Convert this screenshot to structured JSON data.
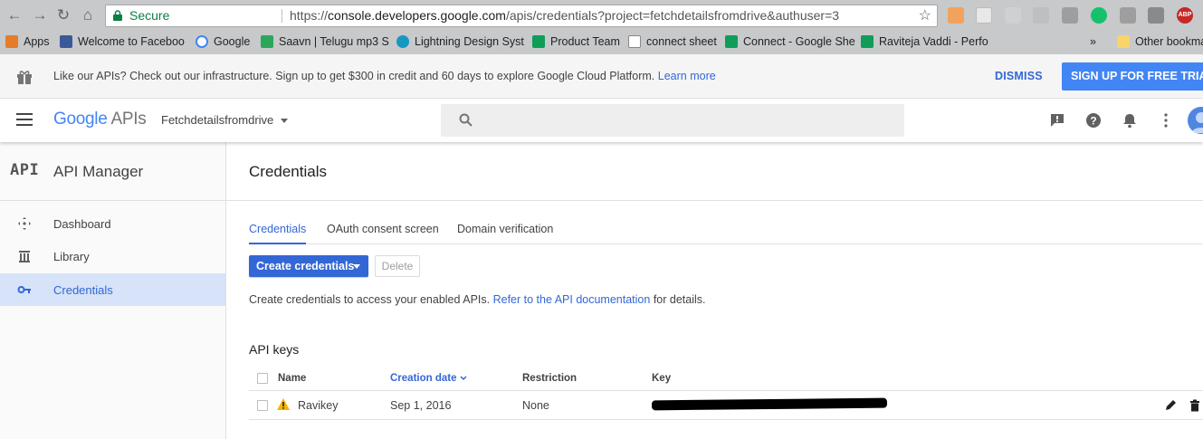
{
  "browser": {
    "secure_label": "Secure",
    "url_scheme": "https://",
    "url_host": "console.developers.google.com",
    "url_path": "/apis/credentials?project=fetchdetailsfromdrive&authuser=3",
    "bookmarks": [
      "Apps",
      "Welcome to Faceboo",
      "Google",
      "Saavn | Telugu mp3 S",
      "Lightning Design Syst",
      "Product Team",
      "connect sheet",
      "Connect - Google She",
      "Raviteja Vaddi - Perfo",
      "»",
      "Other bookmar"
    ],
    "ext_badge": "ABP"
  },
  "promo": {
    "message": "Like our APIs? Check out our infrastructure. Sign up to get $300 in credit and 60 days to explore Google Cloud Platform.",
    "learn_more": "Learn more",
    "dismiss": "DISMISS",
    "signup": "SIGN UP FOR FREE TRIA"
  },
  "header": {
    "logo_google": "Google",
    "logo_apis": "APIs",
    "project": "Fetchdetailsfromdrive",
    "search_placeholder": ""
  },
  "sidebar": {
    "mark": "API",
    "title": "API Manager",
    "items": [
      {
        "label": "Dashboard",
        "icon": "dashboard-icon"
      },
      {
        "label": "Library",
        "icon": "library-icon"
      },
      {
        "label": "Credentials",
        "icon": "key-icon",
        "active": true
      }
    ]
  },
  "main": {
    "title": "Credentials",
    "tabs": [
      "Credentials",
      "OAuth consent screen",
      "Domain verification"
    ],
    "create_button": "Create credentials",
    "delete_button": "Delete",
    "hint_prefix": "Create credentials to access your enabled APIs.",
    "hint_link": "Refer to the API documentation",
    "hint_suffix": "for details.",
    "section_title": "API keys",
    "table": {
      "columns": [
        "Name",
        "Creation date",
        "Restriction",
        "Key"
      ],
      "rows": [
        {
          "name": "Ravikey",
          "date": "Sep 1, 2016",
          "restriction": "None"
        }
      ]
    }
  },
  "colors": {
    "accent": "#3367d6",
    "signup_bg": "#4285f4",
    "sidebar_active": "#d6e3f8",
    "warning": "#f4b400"
  }
}
